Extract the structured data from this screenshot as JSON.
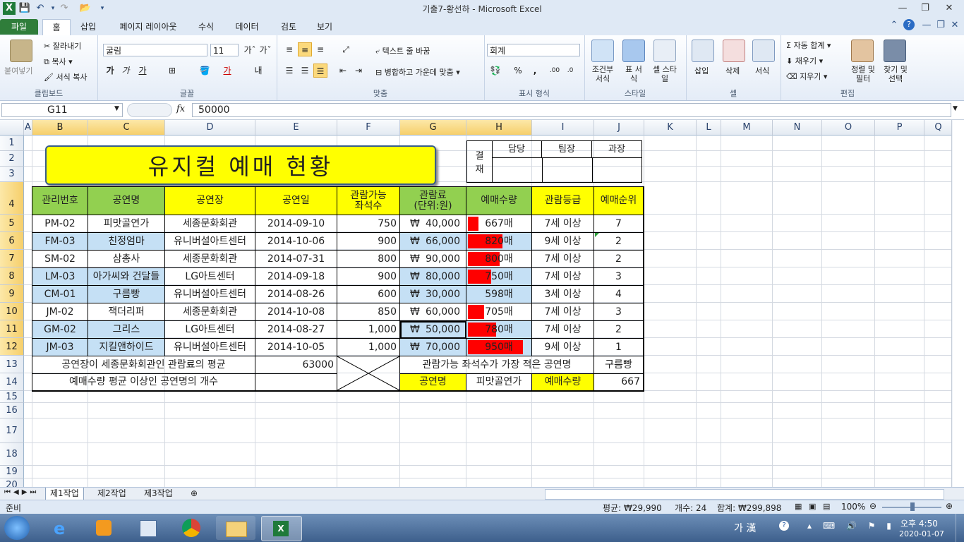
{
  "window": {
    "title": "기출7-황선하  -  Microsoft Excel"
  },
  "tabs": [
    "파일",
    "홈",
    "삽입",
    "페이지 레이아웃",
    "수식",
    "데이터",
    "검토",
    "보기"
  ],
  "ribbon": {
    "clipboard": {
      "label": "클립보드",
      "paste": "붙여넣기",
      "cut": "잘라내기",
      "copy": "복사",
      "format_painter": "서식 복사"
    },
    "font": {
      "label": "글꼴",
      "name": "굴림",
      "size": "11",
      "bold": "가",
      "italic": "가",
      "underline": "가"
    },
    "align": {
      "label": "맞춤",
      "wrap": "텍스트 줄 바꿈",
      "merge": "병합하고 가운데 맞춤"
    },
    "number": {
      "label": "표시 형식",
      "format": "회계",
      "percent": "%",
      "comma": ","
    },
    "styles": {
      "label": "스타일",
      "conditional": "조건부 서식",
      "table": "표 서식",
      "cell": "셀 스타일"
    },
    "cells": {
      "label": "셀",
      "insert": "삽입",
      "delete": "삭제",
      "format": "서식"
    },
    "editing": {
      "label": "편집",
      "autosum": "자동 합계",
      "fill": "채우기",
      "clear": "지우기",
      "sort": "정렬 및 필터",
      "find": "찾기 및 선택"
    }
  },
  "formula_bar": {
    "name_box": "G11",
    "fx": "fx",
    "value": "50000"
  },
  "columns": [
    "A",
    "B",
    "C",
    "D",
    "E",
    "F",
    "G",
    "H",
    "I",
    "J",
    "K",
    "L",
    "M",
    "N",
    "O",
    "P",
    "Q"
  ],
  "rows": [
    "1",
    "2",
    "3",
    "4",
    "5",
    "6",
    "7",
    "8",
    "9",
    "10",
    "11",
    "12",
    "13",
    "14",
    "15",
    "16",
    "17",
    "18",
    "19",
    "20"
  ],
  "sheet": {
    "title": "유지컬 예매 현황",
    "approval": {
      "label1": "결",
      "label2": "재",
      "c1": "담당",
      "c2": "팀장",
      "c3": "과장"
    },
    "headers": [
      "관리번호",
      "공연명",
      "공연장",
      "공연일",
      "관람가능\n좌석수",
      "관람료\n(단위:원)",
      "예매수량",
      "관람등급",
      "예매순위"
    ],
    "data": [
      {
        "id": "PM-02",
        "name": "피맛골연가",
        "venue": "세종문화회관",
        "date": "2014-09-10",
        "seats": "750",
        "fee": "40,000",
        "qty": "667매",
        "qty_n": 667,
        "grade": "7세 이상",
        "rank": "7"
      },
      {
        "id": "FM-03",
        "name": "친정엄마",
        "venue": "유니버설아트센터",
        "date": "2014-10-06",
        "seats": "900",
        "fee": "66,000",
        "qty": "820매",
        "qty_n": 820,
        "grade": "9세 이상",
        "rank": "2"
      },
      {
        "id": "SM-02",
        "name": "삼총사",
        "venue": "세종문화회관",
        "date": "2014-07-31",
        "seats": "800",
        "fee": "90,000",
        "qty": "800매",
        "qty_n": 800,
        "grade": "7세 이상",
        "rank": "2"
      },
      {
        "id": "LM-03",
        "name": "아가씨와 건달들",
        "venue": "LG아트센터",
        "date": "2014-09-18",
        "seats": "900",
        "fee": "80,000",
        "qty": "750매",
        "qty_n": 750,
        "grade": "7세 이상",
        "rank": "3"
      },
      {
        "id": "CM-01",
        "name": "구름빵",
        "venue": "유니버설아트센터",
        "date": "2014-08-26",
        "seats": "600",
        "fee": "30,000",
        "qty": "598매",
        "qty_n": 598,
        "grade": "3세 이상",
        "rank": "4"
      },
      {
        "id": "JM-02",
        "name": "잭더리퍼",
        "venue": "세종문화회관",
        "date": "2014-10-08",
        "seats": "850",
        "fee": "60,000",
        "qty": "705매",
        "qty_n": 705,
        "grade": "7세 이상",
        "rank": "3"
      },
      {
        "id": "GM-02",
        "name": "그리스",
        "venue": "LG아트센터",
        "date": "2014-08-27",
        "seats": "1,000",
        "fee": "50,000",
        "qty": "780매",
        "qty_n": 780,
        "grade": "7세 이상",
        "rank": "2"
      },
      {
        "id": "JM-03",
        "name": "지킬앤하이드",
        "venue": "유니버설아트센터",
        "date": "2014-10-05",
        "seats": "1,000",
        "fee": "70,000",
        "qty": "950매",
        "qty_n": 950,
        "grade": "9세 이상",
        "rank": "1"
      }
    ],
    "currency": "₩",
    "summary": {
      "r13_label": "공연장이 세종문화회관인 관람료의 평균",
      "r13_value": "63000",
      "r13_label2": "관람가능 좌석수가 가장 적은 공연명",
      "r13_value2": "구름빵",
      "r14_label": "예매수량 평균 이상인 공연명의 개수",
      "r14_key1": "공연명",
      "r14_val1": "피맛골연가",
      "r14_key2": "예매수량",
      "r14_val2": "667"
    }
  },
  "sheet_tabs": [
    "제1작업",
    "제2작업",
    "제3작업"
  ],
  "status": {
    "ready": "준비",
    "avg": "평균: ₩29,990",
    "count": "개수: 24",
    "sum": "합계: ₩299,898",
    "zoom": "100%"
  },
  "taskbar": {
    "ime": "가 漢",
    "time": "오후 4:50",
    "date": "2020-01-07"
  }
}
